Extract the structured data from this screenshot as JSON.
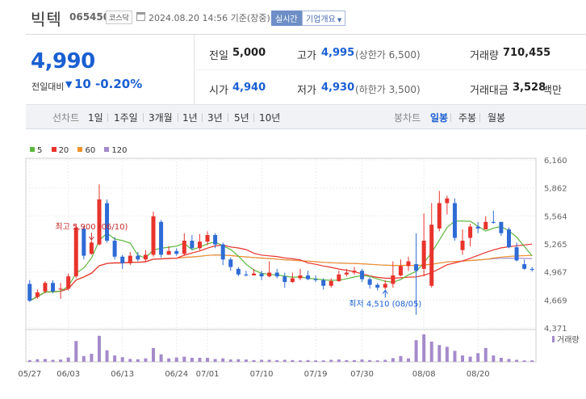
{
  "header": {
    "name": "빅텍",
    "code": "065450",
    "market": "코스닥",
    "datetime": "2024.08.20 14:56 기준(장중)",
    "realtime_label": "실시간",
    "company_label": "기업개요"
  },
  "summary": {
    "price": "4,990",
    "change_label": "전일대비",
    "change_value": "10",
    "change_pct": "-0.20%",
    "prev_label": "전일",
    "prev_value": "5,000",
    "high_label": "고가",
    "high_value": "4,995",
    "high_sub": "(상한가 6,500)",
    "volume_label": "거래량",
    "volume_value": "710,455",
    "open_label": "시가",
    "open_value": "4,940",
    "low_label": "저가",
    "low_value": "4,930",
    "low_sub": "(하한가 3,500)",
    "amount_label": "거래대금",
    "amount_value": "3,528",
    "amount_unit": "백만"
  },
  "tabs": {
    "line_label": "선차트",
    "line_items": [
      "1일",
      "1주일",
      "3개월",
      "1년",
      "3년",
      "5년",
      "10년"
    ],
    "candle_label": "봉차트",
    "candle_items": [
      "일봉",
      "주봉",
      "월봉"
    ],
    "active_candle": "일봉"
  },
  "colors": {
    "up": "#e8332c",
    "down": "#2f6bd5",
    "volume": "#a48bcb",
    "ma5": "#5db83f",
    "ma20": "#e8332c",
    "ma60": "#f0932b",
    "ma120": "#a48bcb"
  },
  "chart_data": {
    "type": "candlestick",
    "legend": [
      "5",
      "20",
      "60",
      "120"
    ],
    "y_ticks": [
      "6,160",
      "5,862",
      "5,564",
      "5,265",
      "4,967",
      "4,669",
      "4,371"
    ],
    "ylim": [
      4371,
      6160
    ],
    "x_labels": [
      "05/27",
      "06/03",
      "06/13",
      "06/24",
      "07/01",
      "07/10",
      "07/19",
      "07/30",
      "08/08",
      "08/20"
    ],
    "x_label_index": [
      0,
      5,
      12,
      19,
      23,
      30,
      37,
      43,
      51,
      58
    ],
    "volume_label": "거래량",
    "high_annotation": "최고 5,900 (06/10)",
    "low_annotation": "최저 4,510 (08/05)",
    "high_index": 8,
    "low_index": 46,
    "candles": [
      [
        4840,
        4660,
        4880,
        4650
      ],
      [
        4700,
        4750,
        4780,
        4680
      ],
      [
        4760,
        4850,
        4870,
        4740
      ],
      [
        4850,
        4760,
        4880,
        4740
      ],
      [
        4780,
        4790,
        4850,
        4680
      ],
      [
        4790,
        4920,
        4950,
        4770
      ],
      [
        4920,
        5440,
        5480,
        4900
      ],
      [
        5430,
        5140,
        5450,
        5100
      ],
      [
        5160,
        5280,
        5300,
        5150
      ],
      [
        5260,
        5740,
        5900,
        5250
      ],
      [
        5700,
        5300,
        5740,
        5280
      ],
      [
        5300,
        5130,
        5340,
        5100
      ],
      [
        5130,
        5060,
        5150,
        5000
      ],
      [
        5060,
        5140,
        5180,
        5040
      ],
      [
        5140,
        5100,
        5180,
        5080
      ],
      [
        5100,
        5150,
        5200,
        5080
      ],
      [
        5150,
        5560,
        5610,
        5130
      ],
      [
        5500,
        5150,
        5520,
        5120
      ],
      [
        5150,
        5190,
        5240,
        5150
      ],
      [
        5190,
        5160,
        5220,
        5140
      ],
      [
        5160,
        5300,
        5380,
        5140
      ],
      [
        5300,
        5220,
        5360,
        5200
      ],
      [
        5220,
        5290,
        5370,
        5200
      ],
      [
        5290,
        5360,
        5400,
        5250
      ],
      [
        5360,
        5260,
        5380,
        5220
      ],
      [
        5260,
        5100,
        5280,
        5040
      ],
      [
        5100,
        5020,
        5120,
        4980
      ],
      [
        5000,
        4940,
        5020,
        4920
      ],
      [
        4940,
        4930,
        4980,
        4920
      ],
      [
        4930,
        4950,
        5000,
        4930
      ],
      [
        4950,
        4920,
        4980,
        4880
      ],
      [
        4920,
        4960,
        5080,
        4910
      ],
      [
        4960,
        4920,
        5000,
        4900
      ],
      [
        4920,
        4860,
        4960,
        4800
      ],
      [
        4860,
        4900,
        4960,
        4850
      ],
      [
        4900,
        4930,
        5000,
        4880
      ],
      [
        4930,
        4890,
        4980,
        4880
      ],
      [
        4890,
        4880,
        4930,
        4860
      ],
      [
        4880,
        4820,
        4900,
        4780
      ],
      [
        4820,
        4870,
        4900,
        4800
      ],
      [
        4870,
        4940,
        4980,
        4860
      ],
      [
        4940,
        4960,
        5000,
        4920
      ],
      [
        4960,
        4980,
        5020,
        4940
      ],
      [
        4980,
        4890,
        5000,
        4860
      ],
      [
        4890,
        4830,
        4910,
        4790
      ],
      [
        4830,
        4800,
        4850,
        4770
      ],
      [
        4800,
        4840,
        4880,
        4780
      ],
      [
        4840,
        4930,
        5080,
        4800
      ],
      [
        4930,
        5030,
        5100,
        4920
      ],
      [
        5030,
        5080,
        5130,
        4980
      ],
      [
        5050,
        4980,
        5380,
        4510
      ],
      [
        5000,
        5300,
        5590,
        4920
      ],
      [
        4820,
        5470,
        5700,
        4800
      ],
      [
        5430,
        5700,
        5830,
        5400
      ],
      [
        5700,
        5750,
        5780,
        5580
      ],
      [
        5700,
        5330,
        5750,
        5300
      ],
      [
        5200,
        5300,
        5420,
        5150
      ],
      [
        5330,
        5450,
        5480,
        5240
      ],
      [
        5450,
        5430,
        5500,
        5380
      ],
      [
        5420,
        5500,
        5560,
        5430
      ],
      [
        5500,
        5490,
        5620,
        5480
      ],
      [
        5500,
        5380,
        5480,
        5350
      ],
      [
        5420,
        5230,
        5440,
        5220
      ],
      [
        5230,
        5090,
        5280,
        5080
      ],
      [
        5050,
        5000,
        5100,
        4990
      ],
      [
        5000,
        4990,
        5020,
        4970
      ]
    ],
    "volumes": [
      6,
      9,
      10,
      7,
      8,
      15,
      72,
      20,
      28,
      90,
      40,
      22,
      16,
      10,
      9,
      12,
      48,
      26,
      12,
      15,
      18,
      14,
      14,
      14,
      10,
      12,
      8,
      9,
      8,
      6,
      7,
      7,
      6,
      7,
      6,
      5,
      6,
      5,
      5,
      7,
      8,
      6,
      6,
      8,
      6,
      5,
      7,
      13,
      20,
      12,
      75,
      95,
      70,
      58,
      52,
      38,
      22,
      18,
      30,
      48,
      22,
      14,
      10,
      7,
      5,
      5
    ]
  }
}
